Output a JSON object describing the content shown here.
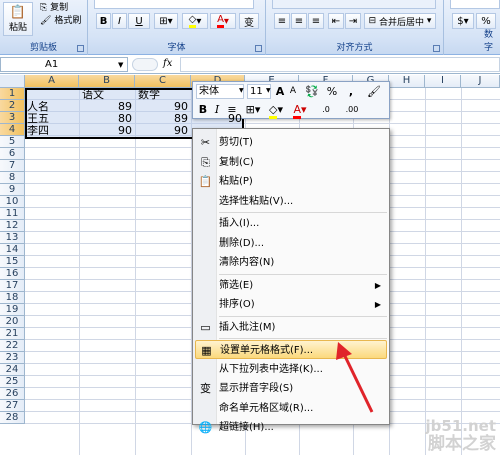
{
  "ribbon": {
    "clipboard": {
      "paste_label": "粘贴",
      "copy_label": "复制",
      "format_painter_label": "格式刷",
      "group_label": "剪贴板"
    },
    "font": {
      "bold": "B",
      "italic": "I",
      "underline": "U",
      "grow_char": "变",
      "font_color_letter": "A",
      "group_label": "字体"
    },
    "alignment": {
      "merge_label": "合并后居中",
      "group_label": "对齐方式"
    },
    "number": {
      "group_label": "数字"
    }
  },
  "formula_bar": {
    "name_box": "A1",
    "fx": "fx"
  },
  "columns": [
    "A",
    "B",
    "C",
    "D",
    "E",
    "F",
    "G",
    "H",
    "I",
    "J"
  ],
  "rows": [
    "1",
    "2",
    "3",
    "4",
    "5",
    "6",
    "7",
    "8",
    "9",
    "10",
    "11",
    "12",
    "13",
    "14",
    "15",
    "16",
    "17",
    "18",
    "19",
    "20",
    "21",
    "22",
    "23",
    "24",
    "25",
    "26",
    "27",
    "28"
  ],
  "cells": {
    "r1": {
      "b": "语文",
      "c": "数学"
    },
    "r2": {
      "a": "人名",
      "b": "89",
      "c": "90"
    },
    "r3": {
      "a": "王五",
      "b": "80",
      "c": "89"
    },
    "r4": {
      "a": "李四",
      "b": "90",
      "c": "90",
      "d": "90"
    }
  },
  "mini_toolbar": {
    "font_name": "宋体",
    "font_size": "11",
    "grow": "A",
    "shrink": "A",
    "percent": "%",
    "comma": ",",
    "bold": "B",
    "italic": "I",
    "font_color": "A",
    "increase_decimal": ".0",
    "decrease_decimal": ".00"
  },
  "context_menu": {
    "items": [
      {
        "label": "剪切(T)",
        "icon": "scissors-icon"
      },
      {
        "label": "复制(C)",
        "icon": "copy-icon"
      },
      {
        "label": "粘贴(P)",
        "icon": "paste-icon"
      },
      {
        "label": "选择性粘贴(V)...",
        "icon": ""
      },
      {
        "label": "插入(I)...",
        "icon": ""
      },
      {
        "label": "删除(D)...",
        "icon": ""
      },
      {
        "label": "清除内容(N)",
        "icon": ""
      },
      {
        "label": "筛选(E)",
        "icon": "",
        "submenu": true
      },
      {
        "label": "排序(O)",
        "icon": "",
        "submenu": true
      },
      {
        "label": "插入批注(M)",
        "icon": "comment-icon"
      },
      {
        "label": "设置单元格格式(F)...",
        "icon": "format-cells-icon",
        "highlighted": true
      },
      {
        "label": "从下拉列表中选择(K)...",
        "icon": ""
      },
      {
        "label": "显示拼音字段(S)",
        "icon": "phonetic-icon"
      },
      {
        "label": "命名单元格区域(R)...",
        "icon": ""
      },
      {
        "label": "超链接(H)...",
        "icon": "hyperlink-icon"
      }
    ]
  },
  "watermark": {
    "line1": "jb51.net",
    "line2": "脚本之家"
  },
  "colors": {
    "accent": "#fbd97d",
    "ribbon": "#d5e3f6",
    "arrow": "#e0242a"
  }
}
